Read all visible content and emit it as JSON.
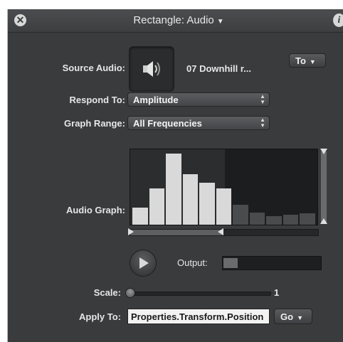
{
  "title": "Rectangle: Audio",
  "labels": {
    "source_audio": "Source Audio:",
    "respond_to": "Respond To:",
    "graph_range": "Graph Range:",
    "audio_graph": "Audio Graph:",
    "output": "Output:",
    "scale": "Scale:",
    "apply_to": "Apply To:"
  },
  "source_file": "07 Downhill r...",
  "to_button": "To",
  "respond_to_value": "Amplitude",
  "graph_range_value": "All Frequencies",
  "audio_graph": {
    "bar_levels": [
      0.24,
      0.5,
      0.98,
      0.7,
      0.58,
      0.5,
      0.27,
      0.17,
      0.12,
      0.14,
      0.16
    ],
    "highlighted_bars": 6
  },
  "output_level": 0.15,
  "scale_value": "1",
  "apply_to_value": "Properties.Transform.Position",
  "go_button": "Go",
  "colors": {
    "panel_bg": "#3a3b3d",
    "bar_active": "#d9d9d9",
    "bar_inactive": "#4a4b4d"
  }
}
